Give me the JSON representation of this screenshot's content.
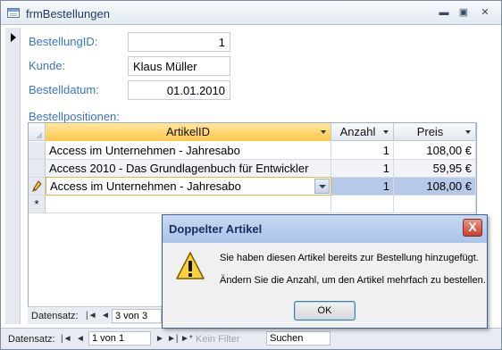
{
  "window": {
    "title": "frmBestellungen"
  },
  "fields": {
    "bestellung_id": {
      "label": "BestellungID:",
      "value": "1"
    },
    "kunde": {
      "label": "Kunde:",
      "value": "Klaus Müller"
    },
    "bestelldatum": {
      "label": "Bestelldatum:",
      "value": "01.01.2010"
    }
  },
  "subform": {
    "label": "Bestellpositionen:",
    "columns": [
      "ArtikelID",
      "Anzahl",
      "Preis"
    ],
    "rows": [
      {
        "artikel": "Access im Unternehmen - Jahresabo",
        "anzahl": "1",
        "preis": "108,00 €"
      },
      {
        "artikel": "Access 2010 - Das Grundlagenbuch für Entwickler",
        "anzahl": "1",
        "preis": "59,95 €"
      },
      {
        "artikel": "Access im Unternehmen - Jahresabo",
        "anzahl": "1",
        "preis": "108,00 €"
      }
    ],
    "new_row_marker": "*",
    "nav": {
      "label": "Datensatz:",
      "position": "3 von 3"
    }
  },
  "main_nav": {
    "label": "Datensatz:",
    "position": "1 von 1",
    "filter": "Kein Filter",
    "search": "Suchen"
  },
  "dialog": {
    "title": "Doppelter Artikel",
    "message1": "Sie haben diesen Artikel bereits zur Bestellung hinzugefügt.",
    "message2": "Ändern Sie die Anzahl, um den Artikel mehrfach zu bestellen.",
    "ok": "OK",
    "close": "X"
  }
}
